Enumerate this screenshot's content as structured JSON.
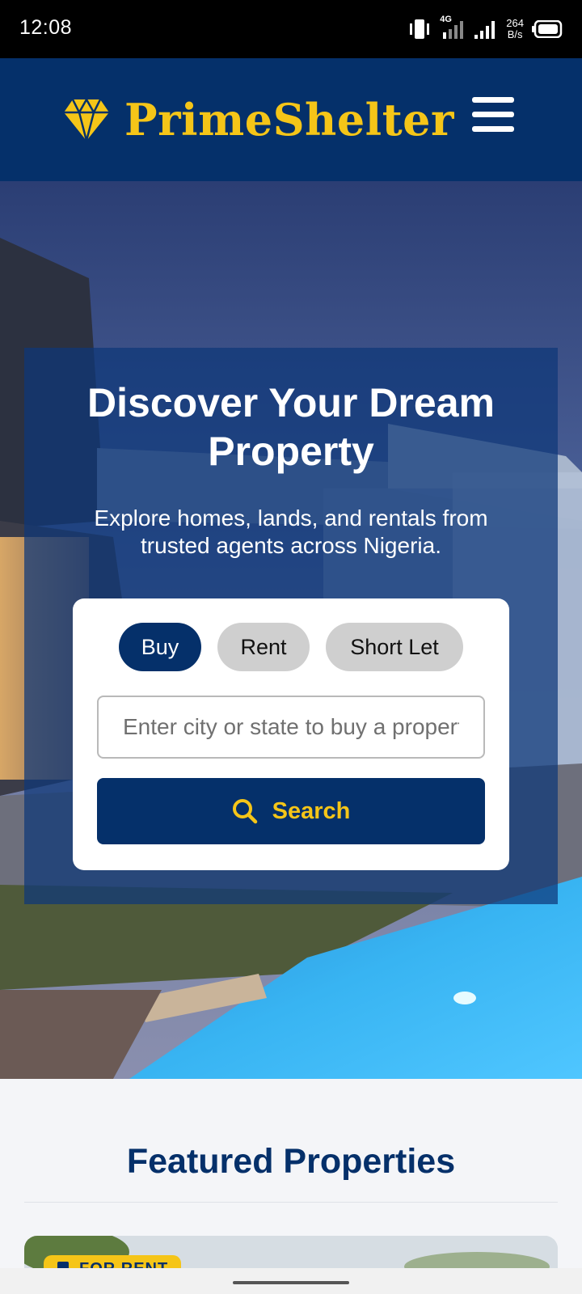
{
  "status_bar": {
    "time": "12:08",
    "network": "4G",
    "speed_value": "264",
    "speed_unit": "B/s"
  },
  "header": {
    "brand_name": "PrimeShelter",
    "logo_icon": "diamond-icon",
    "menu_icon": "hamburger-menu-icon"
  },
  "hero": {
    "title": "Discover Your Dream Property",
    "subtitle": "Explore homes, lands, and rentals from trusted agents across Nigeria."
  },
  "search": {
    "tabs": [
      {
        "label": "Buy",
        "active": true
      },
      {
        "label": "Rent",
        "active": false
      },
      {
        "label": "Short Let",
        "active": false
      }
    ],
    "placeholder": "Enter city or state to buy a property",
    "button_label": "Search",
    "button_icon": "search-icon"
  },
  "featured": {
    "title": "Featured Properties",
    "badge_label": "FOR RENT"
  },
  "colors": {
    "brand_blue": "#05306a",
    "brand_yellow": "#f5c518"
  }
}
